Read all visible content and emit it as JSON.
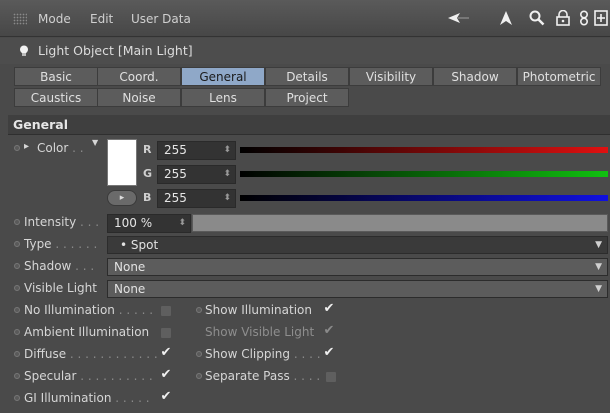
{
  "menubar": {
    "items": [
      "Mode",
      "Edit",
      "User Data"
    ],
    "icons": [
      "back-arrow-icon",
      "cursor-arrow-icon",
      "search-icon",
      "lock-icon",
      "link-icon",
      "new-panel-icon"
    ]
  },
  "object": {
    "title": "Light Object [Main Light]"
  },
  "tabs": {
    "row1": [
      "Basic",
      "Coord.",
      "General",
      "Details",
      "Visibility",
      "Shadow",
      "Photometric"
    ],
    "row2": [
      "Caustics",
      "Noise",
      "Lens",
      "Project"
    ],
    "active": "General"
  },
  "section": {
    "title": "General"
  },
  "color": {
    "label": "Color",
    "dots": " . .",
    "r_label": "R",
    "r": "255",
    "g_label": "G",
    "g": "255",
    "b_label": "B",
    "b": "255",
    "toggle": "▸"
  },
  "intensity": {
    "label": "Intensity",
    "dots": " . . .",
    "value": "100 %"
  },
  "type": {
    "label": "Type",
    "dots": " . . . . . .",
    "value": "• Spot"
  },
  "shadow": {
    "label": "Shadow",
    "dots": " . . .",
    "value": "None"
  },
  "visible_light": {
    "label": "Visible Light",
    "value": "None"
  },
  "checks": {
    "no_illum": {
      "label": "No Illumination",
      "dots": " . . . . .",
      "mark": ""
    },
    "ambient_illum": {
      "label": "Ambient Illumination",
      "mark": ""
    },
    "diffuse": {
      "label": "Diffuse",
      "dots": " . . . . . . . . . . . .",
      "mark": "✔"
    },
    "specular": {
      "label": "Specular",
      "dots": " . . . . . . . . . .",
      "mark": "✔"
    },
    "gi_illum": {
      "label": "GI Illumination",
      "dots": " . . . . .",
      "mark": "✔"
    },
    "show_illum": {
      "label": "Show Illumination",
      "mark": "✔"
    },
    "show_visible_light": {
      "label": "Show Visible Light",
      "mark": "✔"
    },
    "show_clipping": {
      "label": "Show Clipping",
      "dots": " . . . .",
      "mark": "✔"
    },
    "separate_pass": {
      "label": "Separate Pass",
      "dots": " . . . .",
      "mark": ""
    }
  },
  "colors": {
    "accent": "#8fa8c8",
    "red": "#e01010",
    "green": "#10c010",
    "blue": "#1010e0"
  }
}
